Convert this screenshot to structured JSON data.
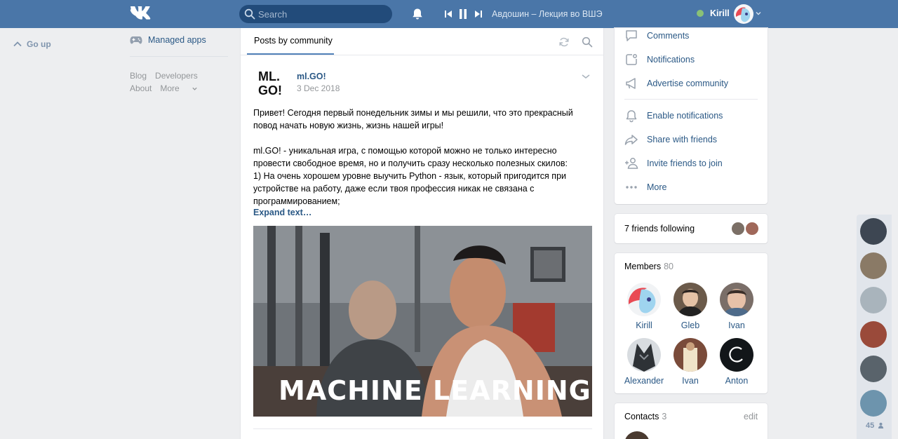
{
  "header": {
    "search_placeholder": "Search",
    "track": "Авдошин – Лекция во ВШЭ",
    "user_name": "Kirill"
  },
  "left_nav": {
    "go_up": "Go up",
    "managed_apps": "Managed apps",
    "footer": {
      "blog": "Blog",
      "developers": "Developers",
      "about": "About",
      "more": "More"
    }
  },
  "main": {
    "tab_active": "Posts by community",
    "post": {
      "author": "ml.GO!",
      "date": "3 Dec 2018",
      "logo_text_top": "ML.",
      "logo_text_bottom": "GO!",
      "paragraph1": "Привет! Сегодня первый понедельник зимы и мы решили, что это прекрасный повод начать новую жизнь, жизнь нашей игры!",
      "paragraph2_line1": "ml.GO! - уникальная игра, с помощью которой можно не только интересно провести свободное время, но и получить сразу несколько полезных скилов:",
      "paragraph2_line2": "1) На очень хорошем уровне выучить Python - язык, который пригодится при устройстве на работу, даже если твоя профессия никак не связана с программированием;",
      "expand": "Expand text…",
      "image_caption": "MACHINE LEARNING"
    }
  },
  "right_menu": {
    "items": [
      {
        "label": "Comments",
        "icon": "comment-icon"
      },
      {
        "label": "Notifications",
        "icon": "notification-settings-icon"
      },
      {
        "label": "Advertise community",
        "icon": "megaphone-icon"
      },
      {
        "label": "Enable notifications",
        "icon": "bell-icon"
      },
      {
        "label": "Share with friends",
        "icon": "share-arrow-icon"
      },
      {
        "label": "Invite friends to join",
        "icon": "add-user-icon"
      },
      {
        "label": "More",
        "icon": "more-dots-icon"
      }
    ]
  },
  "friends_following": {
    "label": "7 friends following"
  },
  "members": {
    "title": "Members",
    "count": "80",
    "list": [
      {
        "name": "Kirill",
        "color": "#e8525b"
      },
      {
        "name": "Gleb",
        "color": "#6b5a4a"
      },
      {
        "name": "Ivan",
        "color": "#7a6e68"
      },
      {
        "name": "Alexander",
        "color": "#2e3236"
      },
      {
        "name": "Ivan",
        "color": "#b38a6a"
      },
      {
        "name": "Anton",
        "color": "#121619"
      }
    ]
  },
  "contacts": {
    "title": "Contacts",
    "count": "3",
    "edit": "edit"
  },
  "friend_strip": {
    "count": "45"
  },
  "colors": {
    "header": "#4a76a8",
    "link": "#2a5885",
    "accent": "#5181b8"
  }
}
